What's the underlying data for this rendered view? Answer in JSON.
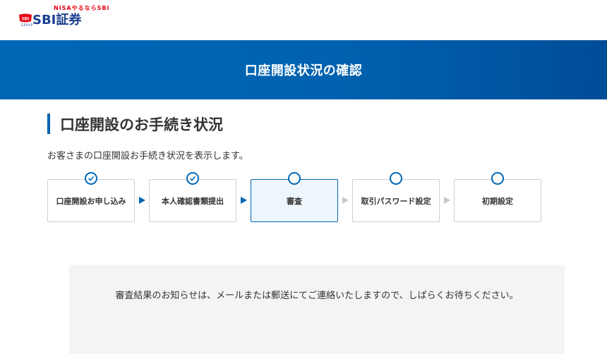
{
  "header": {
    "logo_tagline": "NISAやるならSBI",
    "logo_badge": "SBI",
    "logo_text": "SBI証券",
    "logo_group": "GROUP"
  },
  "banner": {
    "title": "口座開設状況の確認"
  },
  "section": {
    "heading": "口座開設のお手続き状況",
    "description": "お客さまの口座開設お手続き状況を表示します。"
  },
  "steps": [
    {
      "label": "口座開設お申し込み",
      "status": "completed"
    },
    {
      "label": "本人確認書類提出",
      "status": "completed"
    },
    {
      "label": "審査",
      "status": "current"
    },
    {
      "label": "取引パスワード設定",
      "status": "pending"
    },
    {
      "label": "初期設定",
      "status": "pending"
    }
  ],
  "notice": {
    "text": "審査結果のお知らせは、メールまたは郵送にてご連絡いたしますので、しばらくお待ちください。"
  },
  "colors": {
    "brand_blue": "#0062b0",
    "brand_red": "#e60012",
    "inactive_arrow": "#c8c8c8",
    "notice_bg": "#f4f4f4"
  }
}
